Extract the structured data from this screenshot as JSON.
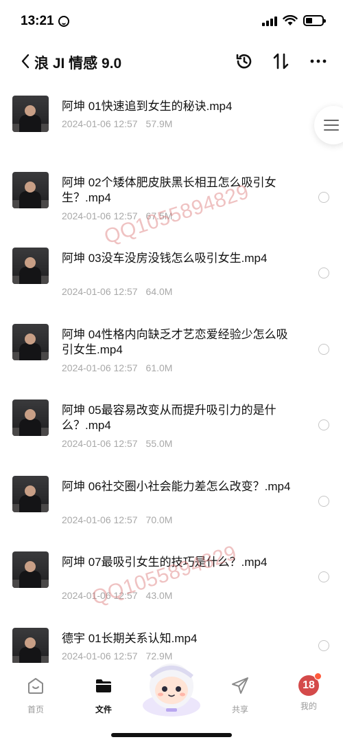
{
  "status_bar": {
    "time": "13:21"
  },
  "header": {
    "title": "浪 JI 情感 9.0",
    "icons": [
      "back-icon",
      "history-icon",
      "sort-icon",
      "more-icon"
    ]
  },
  "files": [
    {
      "name": "阿坤 01快速追到女生的秘诀.mp4",
      "date": "2024-01-06 12:57",
      "size": "57.9M"
    },
    {
      "name": "阿坤 02个矮体肥皮肤黑长相丑怎么吸引女生？.mp4",
      "date": "2024-01-06 12:57",
      "size": "67.5M"
    },
    {
      "name": "阿坤 03没车没房没钱怎么吸引女生.mp4",
      "date": "2024-01-06 12:57",
      "size": "64.0M"
    },
    {
      "name": "阿坤 04性格内向缺乏才艺恋爱经验少怎么吸引女生.mp4",
      "date": "2024-01-06 12:57",
      "size": "61.0M"
    },
    {
      "name": "阿坤 05最容易改变从而提升吸引力的是什么？.mp4",
      "date": "2024-01-06 12:57",
      "size": "55.0M"
    },
    {
      "name": "阿坤 06社交圈小社会能力差怎么改变？.mp4",
      "date": "2024-01-06 12:57",
      "size": "70.0M"
    },
    {
      "name": "阿坤 07最吸引女生的技巧是什么？.mp4",
      "date": "2024-01-06 12:57",
      "size": "43.0M"
    },
    {
      "name": "德宇 01长期关系认知.mp4",
      "date": "2024-01-06 12:57",
      "size": "72.9M"
    }
  ],
  "watermarks": [
    "QQ1055894829",
    "QQ1055894829"
  ],
  "bottom_nav": {
    "home": "首页",
    "files": "文件",
    "share": "共享",
    "mine": "我的",
    "mine_badge": "18"
  },
  "colors": {
    "watermark": "#dc7878",
    "meta_text": "#a8a8a8",
    "badge": "#d44a4a"
  }
}
